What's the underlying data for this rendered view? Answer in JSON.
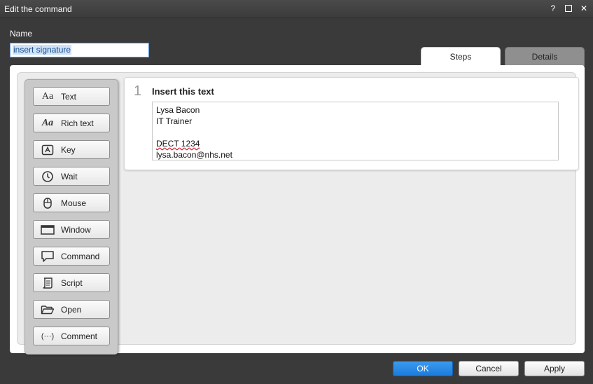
{
  "window": {
    "title": "Edit the command",
    "help_label": "?",
    "close_label": "✕"
  },
  "name": {
    "label": "Name",
    "value": "insert signature"
  },
  "tabs": [
    {
      "label": "Steps",
      "active": true
    },
    {
      "label": "Details",
      "active": false
    }
  ],
  "toolbox": {
    "items": [
      {
        "label": "Text",
        "icon": "text-icon"
      },
      {
        "label": "Rich text",
        "icon": "rich-text-icon"
      },
      {
        "label": "Key",
        "icon": "key-icon"
      },
      {
        "label": "Wait",
        "icon": "clock-icon"
      },
      {
        "label": "Mouse",
        "icon": "mouse-icon"
      },
      {
        "label": "Window",
        "icon": "window-icon"
      },
      {
        "label": "Command",
        "icon": "speech-bubble-icon"
      },
      {
        "label": "Script",
        "icon": "scroll-icon"
      },
      {
        "label": "Open",
        "icon": "folder-open-icon"
      },
      {
        "label": "Comment",
        "icon": "comment-icon"
      }
    ]
  },
  "step": {
    "number": "1",
    "title": "Insert this text",
    "lines": [
      "Lysa Bacon",
      "IT Trainer",
      "",
      "DECT 1234",
      "lysa.bacon@nhs.net"
    ]
  },
  "buttons": {
    "ok": "OK",
    "cancel": "Cancel",
    "apply": "Apply"
  },
  "colors": {
    "accent": "#1c7bdc",
    "background": "#3a3a3a"
  }
}
